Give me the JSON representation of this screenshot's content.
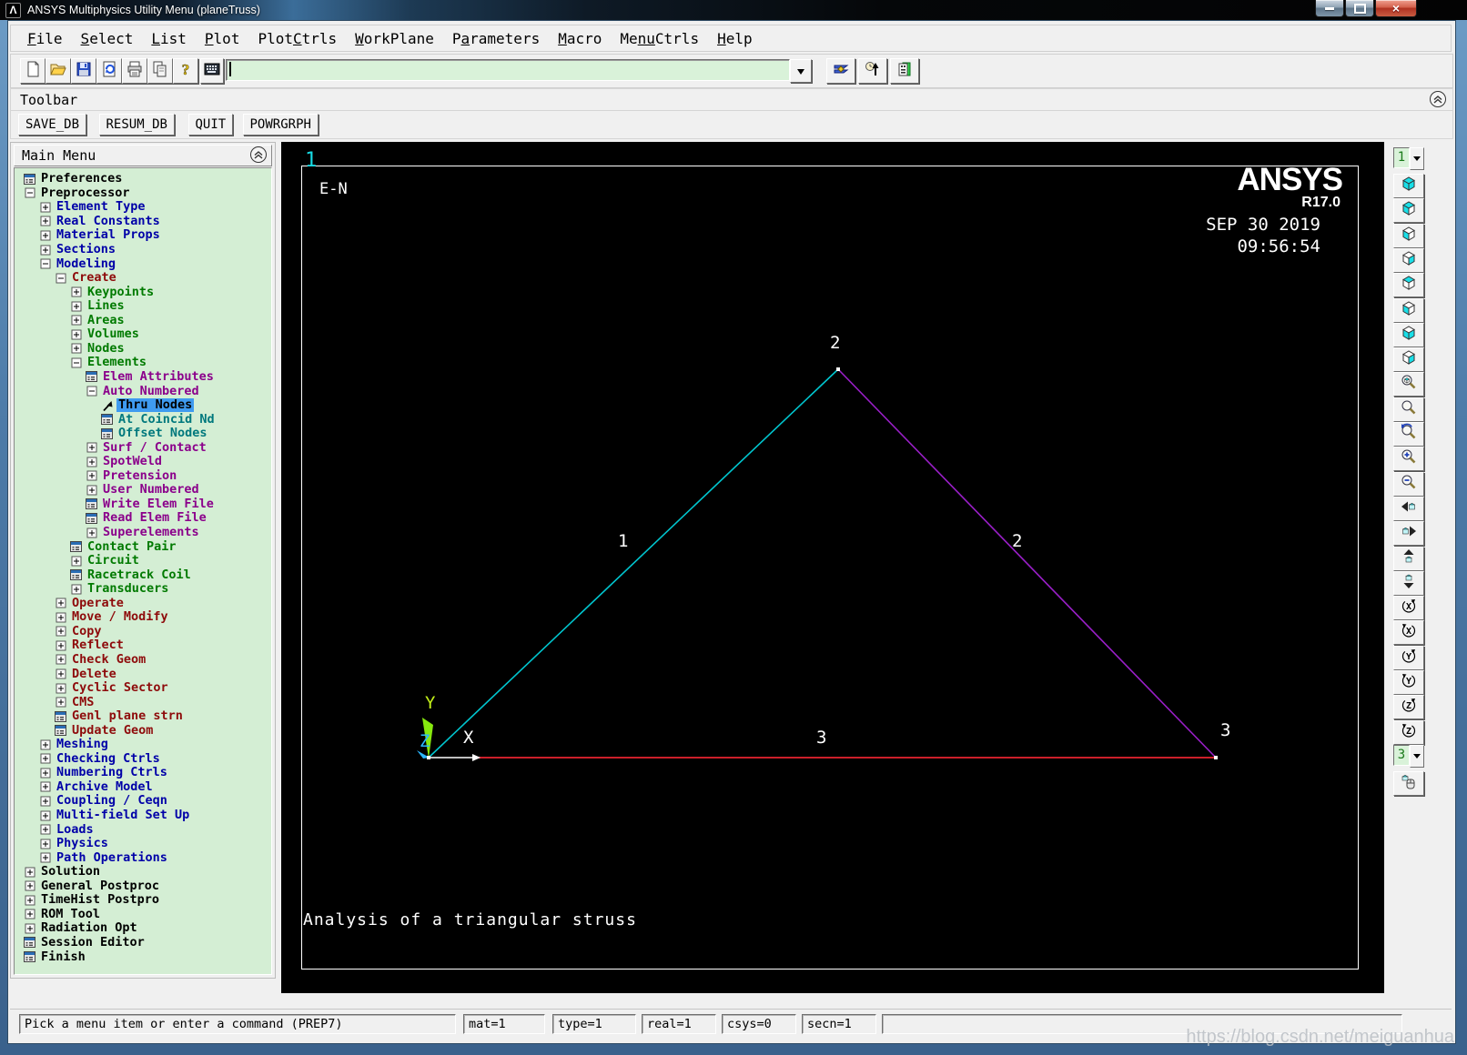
{
  "window": {
    "title": "ANSYS Multiphysics Utility Menu (planeTruss)",
    "logo_glyph": "Λ",
    "controls": [
      "minimize",
      "maximize",
      "close"
    ]
  },
  "menubar": {
    "items": [
      {
        "pre": "",
        "key": "F",
        "post": "ile"
      },
      {
        "pre": "",
        "key": "S",
        "post": "elect"
      },
      {
        "pre": "",
        "key": "L",
        "post": "ist"
      },
      {
        "pre": "",
        "key": "P",
        "post": "lot"
      },
      {
        "pre": "Plot",
        "key": "C",
        "post": "trls"
      },
      {
        "pre": "",
        "key": "W",
        "post": "orkPlane"
      },
      {
        "pre": "P",
        "key": "a",
        "post": "rameters"
      },
      {
        "pre": "",
        "key": "M",
        "post": "acro"
      },
      {
        "pre": "Me",
        "key": "nu",
        "post": "Ctrls"
      },
      {
        "pre": "",
        "key": "H",
        "post": "elp"
      }
    ]
  },
  "toolbar": {
    "file_buttons": [
      "new-file",
      "open-folder",
      "save-disk",
      "report-generator",
      "print",
      "copy-page",
      "help"
    ],
    "command_button": "command-keyboard",
    "command_input": {
      "value": "",
      "placeholder": ""
    },
    "right_buttons": [
      "raise-hidden",
      "reset-picking",
      "contact-manager"
    ]
  },
  "toolbar_panel": {
    "label": "Toolbar",
    "buttons": [
      "SAVE_DB",
      "RESUM_DB",
      "QUIT",
      "POWRGRPH"
    ]
  },
  "main_menu": {
    "title": "Main Menu",
    "colors": {
      "black": "#000000",
      "blue": "#0000a8",
      "red": "#8e0b0b",
      "green": "#007a00",
      "purple": "#8b008b",
      "teal": "#00787d"
    },
    "selection": {
      "bg": "#3f9bf0",
      "text": "#000000"
    },
    "items": [
      {
        "label": "Preferences",
        "icon": "dialog",
        "color": "black",
        "depth": 0
      },
      {
        "label": "Preprocessor",
        "icon": "minus",
        "color": "black",
        "depth": 0
      },
      {
        "label": "Element Type",
        "icon": "plus",
        "color": "blue",
        "depth": 1
      },
      {
        "label": "Real Constants",
        "icon": "plus",
        "color": "blue",
        "depth": 1
      },
      {
        "label": "Material Props",
        "icon": "plus",
        "color": "blue",
        "depth": 1
      },
      {
        "label": "Sections",
        "icon": "plus",
        "color": "blue",
        "depth": 1
      },
      {
        "label": "Modeling",
        "icon": "minus",
        "color": "blue",
        "depth": 1
      },
      {
        "label": "Create",
        "icon": "minus",
        "color": "red",
        "depth": 2
      },
      {
        "label": "Keypoints",
        "icon": "plus",
        "color": "green",
        "depth": 3
      },
      {
        "label": "Lines",
        "icon": "plus",
        "color": "green",
        "depth": 3
      },
      {
        "label": "Areas",
        "icon": "plus",
        "color": "green",
        "depth": 3
      },
      {
        "label": "Volumes",
        "icon": "plus",
        "color": "green",
        "depth": 3
      },
      {
        "label": "Nodes",
        "icon": "plus",
        "color": "green",
        "depth": 3
      },
      {
        "label": "Elements",
        "icon": "minus",
        "color": "green",
        "depth": 3
      },
      {
        "label": "Elem Attributes",
        "icon": "dialog",
        "color": "purple",
        "depth": 4
      },
      {
        "label": "Auto Numbered",
        "icon": "minus",
        "color": "purple",
        "depth": 4
      },
      {
        "label": "Thru Nodes",
        "icon": "pick",
        "color": "black",
        "depth": 5,
        "selected": true
      },
      {
        "label": "At Coincid Nd",
        "icon": "dialog",
        "color": "teal",
        "depth": 5
      },
      {
        "label": "Offset Nodes",
        "icon": "dialog",
        "color": "teal",
        "depth": 5
      },
      {
        "label": "Surf / Contact",
        "icon": "plus",
        "color": "purple",
        "depth": 4
      },
      {
        "label": "SpotWeld",
        "icon": "plus",
        "color": "purple",
        "depth": 4
      },
      {
        "label": "Pretension",
        "icon": "plus",
        "color": "purple",
        "depth": 4
      },
      {
        "label": "User Numbered",
        "icon": "plus",
        "color": "purple",
        "depth": 4
      },
      {
        "label": "Write Elem File",
        "icon": "dialog",
        "color": "purple",
        "depth": 4
      },
      {
        "label": "Read Elem File",
        "icon": "dialog",
        "color": "purple",
        "depth": 4
      },
      {
        "label": "Superelements",
        "icon": "plus",
        "color": "purple",
        "depth": 4
      },
      {
        "label": "Contact Pair",
        "icon": "dialog",
        "color": "green",
        "depth": 3
      },
      {
        "label": "Circuit",
        "icon": "plus",
        "color": "green",
        "depth": 3
      },
      {
        "label": "Racetrack Coil",
        "icon": "dialog",
        "color": "green",
        "depth": 3
      },
      {
        "label": "Transducers",
        "icon": "plus",
        "color": "green",
        "depth": 3
      },
      {
        "label": "Operate",
        "icon": "plus",
        "color": "red",
        "depth": 2
      },
      {
        "label": "Move / Modify",
        "icon": "plus",
        "color": "red",
        "depth": 2
      },
      {
        "label": "Copy",
        "icon": "plus",
        "color": "red",
        "depth": 2
      },
      {
        "label": "Reflect",
        "icon": "plus",
        "color": "red",
        "depth": 2
      },
      {
        "label": "Check Geom",
        "icon": "plus",
        "color": "red",
        "depth": 2
      },
      {
        "label": "Delete",
        "icon": "plus",
        "color": "red",
        "depth": 2
      },
      {
        "label": "Cyclic Sector",
        "icon": "plus",
        "color": "red",
        "depth": 2
      },
      {
        "label": "CMS",
        "icon": "plus",
        "color": "red",
        "depth": 2
      },
      {
        "label": "Genl plane strn",
        "icon": "dialog",
        "color": "red",
        "depth": 2
      },
      {
        "label": "Update Geom",
        "icon": "dialog",
        "color": "red",
        "depth": 2
      },
      {
        "label": "Meshing",
        "icon": "plus",
        "color": "blue",
        "depth": 1
      },
      {
        "label": "Checking Ctrls",
        "icon": "plus",
        "color": "blue",
        "depth": 1
      },
      {
        "label": "Numbering Ctrls",
        "icon": "plus",
        "color": "blue",
        "depth": 1
      },
      {
        "label": "Archive Model",
        "icon": "plus",
        "color": "blue",
        "depth": 1
      },
      {
        "label": "Coupling / Ceqn",
        "icon": "plus",
        "color": "blue",
        "depth": 1
      },
      {
        "label": "Multi-field Set Up",
        "icon": "plus",
        "color": "blue",
        "depth": 1
      },
      {
        "label": "Loads",
        "icon": "plus",
        "color": "blue",
        "depth": 1
      },
      {
        "label": "Physics",
        "icon": "plus",
        "color": "blue",
        "depth": 1
      },
      {
        "label": "Path Operations",
        "icon": "plus",
        "color": "blue",
        "depth": 1
      },
      {
        "label": "Solution",
        "icon": "plus",
        "color": "black",
        "depth": 0
      },
      {
        "label": "General Postproc",
        "icon": "plus",
        "color": "black",
        "depth": 0
      },
      {
        "label": "TimeHist Postpro",
        "icon": "plus",
        "color": "black",
        "depth": 0
      },
      {
        "label": "ROM Tool",
        "icon": "plus",
        "color": "black",
        "depth": 0
      },
      {
        "label": "Radiation Opt",
        "icon": "plus",
        "color": "black",
        "depth": 0
      },
      {
        "label": "Session Editor",
        "icon": "dialog",
        "color": "black",
        "depth": 0
      },
      {
        "label": "Finish",
        "icon": "dialog",
        "color": "black",
        "depth": 0
      }
    ]
  },
  "graphics": {
    "window_id": "1",
    "plot_label": "E-N",
    "brand": "ANSYS",
    "release": "R17.0",
    "date": "SEP 30 2019",
    "time": "09:56:54",
    "plot_title": "Analysis of a triangular struss",
    "labels": {
      "node_2": "2",
      "node_3": "3",
      "elem_1": "1",
      "elem_2": "2",
      "elem_3": "3"
    },
    "triad": {
      "x_label": "X",
      "y_label": "Y",
      "z_label": "Z"
    },
    "colors": {
      "background": "#000000",
      "frame": "#ffffff",
      "window_id": "#17dbe4",
      "elem_1": "#00c6cf",
      "elem_2": "#9a1fc8",
      "elem_3": "#cc1f2a",
      "triad_y": "#86e80e",
      "triad_z": "#2bb7ff",
      "node_marker": "#ffffff"
    }
  },
  "right_toolbar": {
    "buttons": [
      {
        "name": "plot-window-select",
        "type": "dropdown",
        "value": "1"
      },
      {
        "name": "iso-view",
        "type": "cube",
        "faces": "tlr"
      },
      {
        "name": "oblique-view",
        "type": "cube",
        "faces": "tl"
      },
      {
        "name": "front-view",
        "type": "cube",
        "faces": "l"
      },
      {
        "name": "back-view",
        "type": "cube",
        "faces": "r"
      },
      {
        "name": "top-view",
        "type": "cube",
        "faces": "t"
      },
      {
        "name": "bottom-view",
        "type": "cube",
        "faces": "b"
      },
      {
        "name": "left-view",
        "type": "cube",
        "faces": "lo"
      },
      {
        "name": "right-view",
        "type": "cube",
        "faces": "ro"
      },
      {
        "name": "fit-view",
        "type": "zoom-cube"
      },
      {
        "name": "zoom-window",
        "type": "zoom"
      },
      {
        "name": "zoom-back",
        "type": "zoom-back"
      },
      {
        "name": "zoom-in",
        "type": "zoom-in"
      },
      {
        "name": "zoom-out",
        "type": "zoom-out"
      },
      {
        "name": "pan-left",
        "type": "pan",
        "dir": "left"
      },
      {
        "name": "pan-right",
        "type": "pan",
        "dir": "right"
      },
      {
        "name": "pan-up",
        "type": "pan",
        "dir": "up"
      },
      {
        "name": "pan-down",
        "type": "pan",
        "dir": "down"
      },
      {
        "name": "rotate-x-plus",
        "type": "rot",
        "letter": "X"
      },
      {
        "name": "rotate-x-minus",
        "type": "rot",
        "letter": "X"
      },
      {
        "name": "rotate-y-plus",
        "type": "rot",
        "letter": "Y"
      },
      {
        "name": "rotate-y-minus",
        "type": "rot",
        "letter": "Y"
      },
      {
        "name": "rotate-z-plus",
        "type": "rot",
        "letter": "Z"
      },
      {
        "name": "rotate-z-minus",
        "type": "rot",
        "letter": "Z"
      },
      {
        "name": "rotation-rate-select",
        "type": "dropdown",
        "value": "3"
      },
      {
        "name": "dynamic-model-mode",
        "type": "dyn"
      }
    ]
  },
  "status_bar": {
    "prompt": "Pick a menu item or enter a command (PREP7)",
    "fields": [
      "mat=1",
      "type=1",
      "real=1",
      "csys=0",
      "secn=1",
      ""
    ]
  },
  "watermark": "https://blog.csdn.net/meiguanhua"
}
